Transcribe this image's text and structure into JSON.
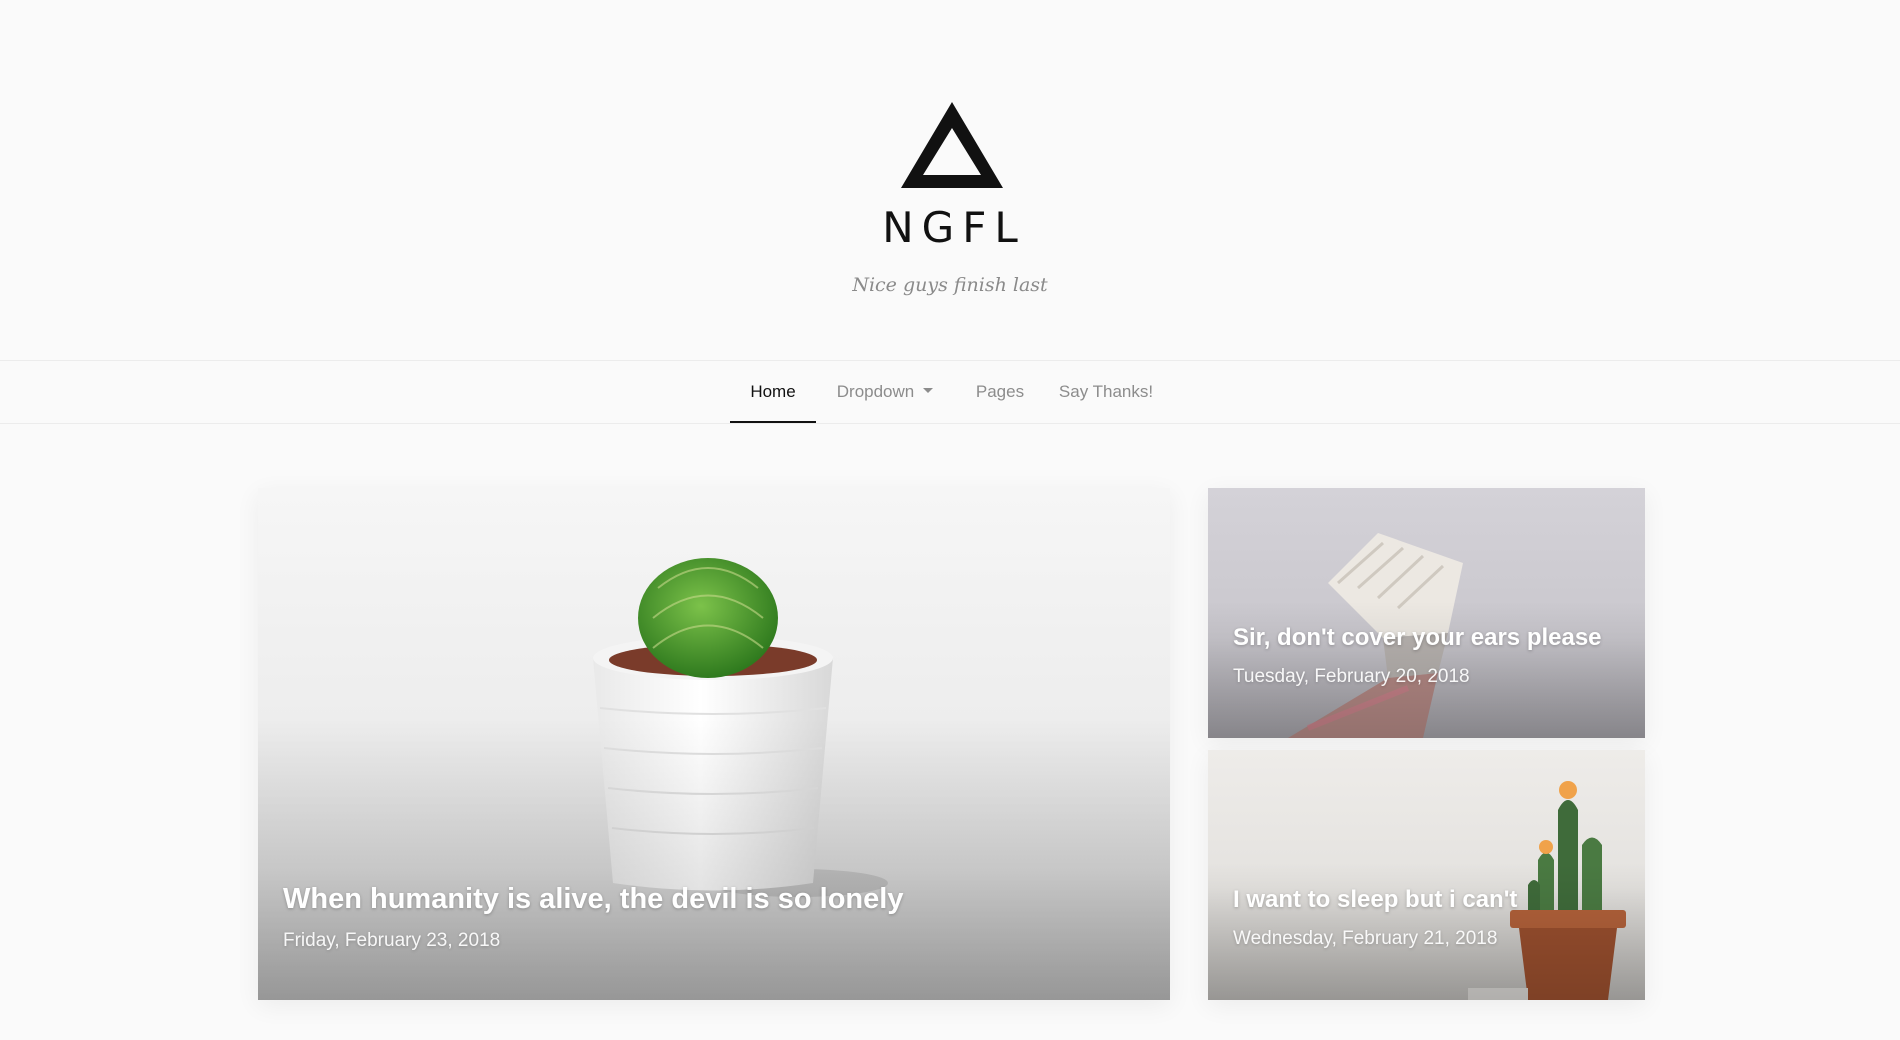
{
  "site": {
    "name": "NGFL",
    "tagline": "Nice guys finish last",
    "logo_icon": "triangle-logo-icon"
  },
  "nav": {
    "items": [
      {
        "label": "Home",
        "active": true
      },
      {
        "label": "Dropdown",
        "has_caret": true
      },
      {
        "label": "Pages"
      },
      {
        "label": "Say Thanks!"
      }
    ]
  },
  "posts": [
    {
      "title": "When humanity is alive, the devil is so lonely",
      "date": "Friday, February 23, 2018",
      "image": "cactus-in-white-pot"
    },
    {
      "title": "Sir, don't cover your ears please",
      "date": "Tuesday, February 20, 2018",
      "image": "paint-brush"
    },
    {
      "title": "I want to sleep but i can't",
      "date": "Wednesday, February 21, 2018",
      "image": "flowering-cactus-in-terracotta-pot"
    }
  ],
  "colors": {
    "background": "#fafafa",
    "text_dark": "#111111",
    "text_muted": "#8c8c8c",
    "card_text": "#ffffff"
  }
}
